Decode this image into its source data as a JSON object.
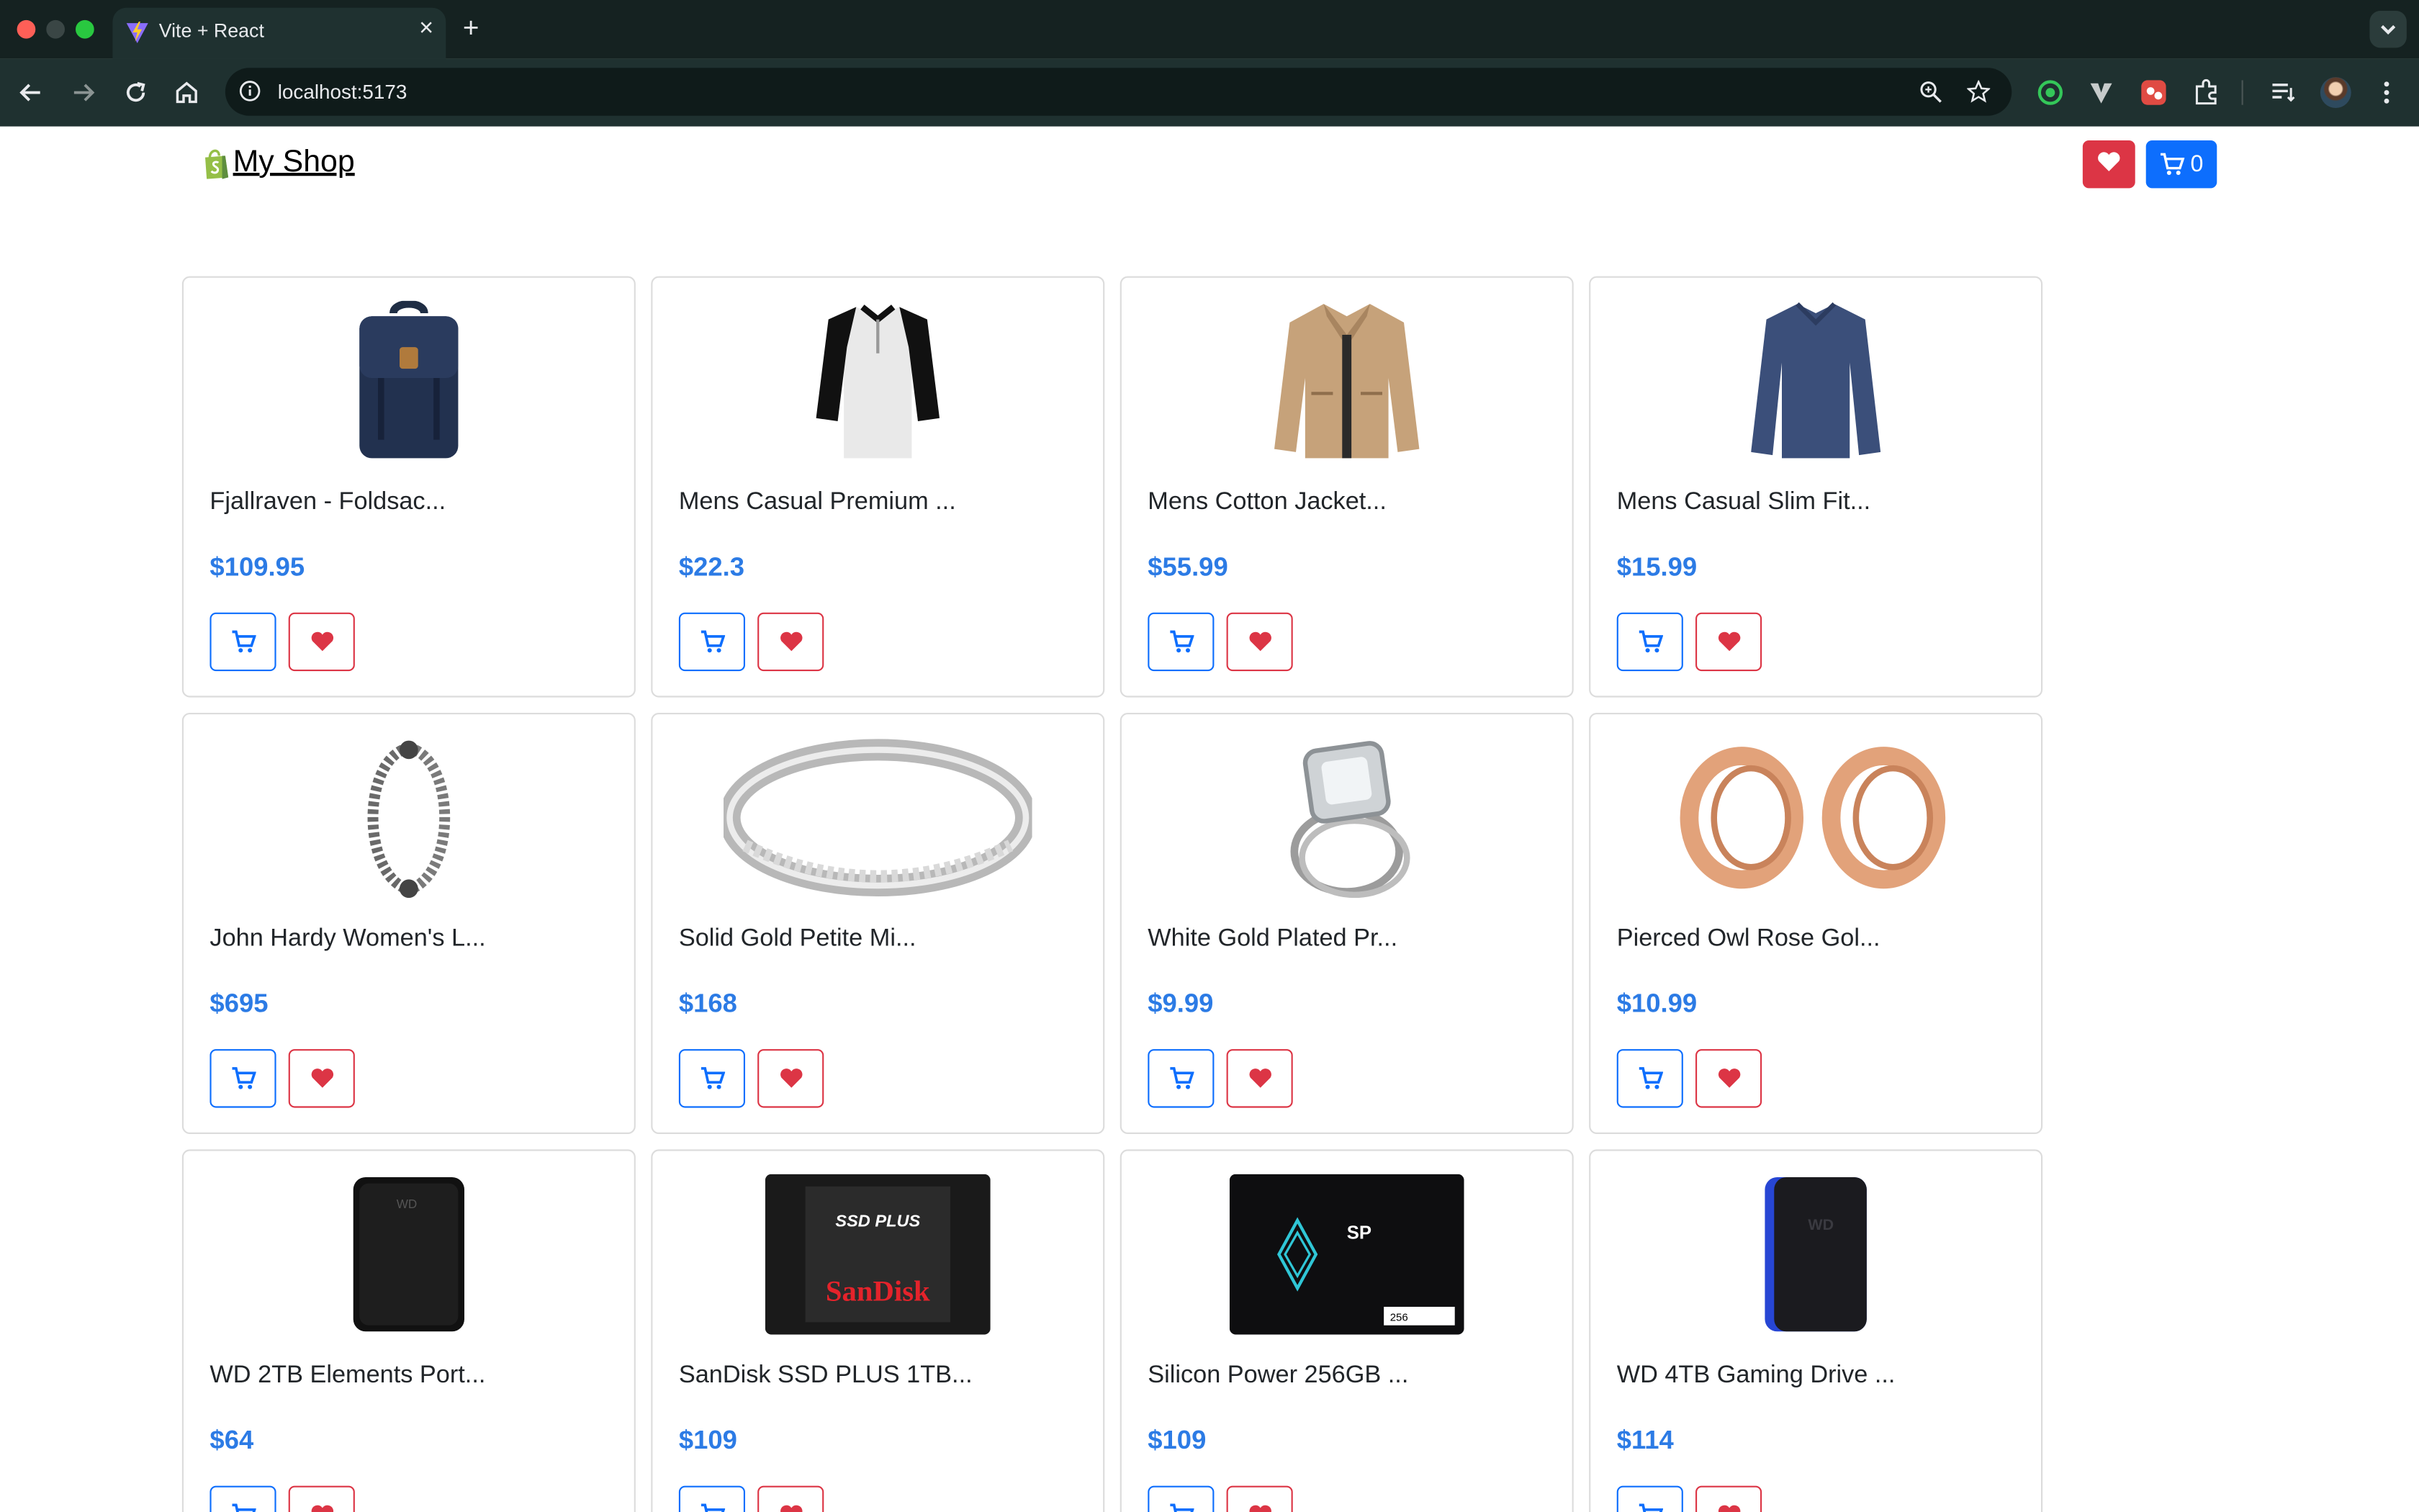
{
  "browser": {
    "tab_title": "Vite + React",
    "url": "localhost:5173"
  },
  "header": {
    "brand": "My Shop",
    "cart_count": "0"
  },
  "colors": {
    "primary": "#0d6efd",
    "danger": "#dc3545",
    "price": "#2c7be5"
  },
  "products": [
    {
      "title": "Fjallraven - Foldsac...",
      "price": "$109.95",
      "image": "backpack"
    },
    {
      "title": "Mens Casual Premium ...",
      "price": "$22.3",
      "image": "henley-shirt"
    },
    {
      "title": "Mens Cotton Jacket...",
      "price": "$55.99",
      "image": "jacket"
    },
    {
      "title": "Mens Casual Slim Fit...",
      "price": "$15.99",
      "image": "long-sleeve-tee"
    },
    {
      "title": "John Hardy Women's L...",
      "price": "$695",
      "image": "chain-bracelet"
    },
    {
      "title": "Solid Gold Petite Mi...",
      "price": "$168",
      "image": "silver-ring"
    },
    {
      "title": "White Gold Plated Pr...",
      "price": "$9.99",
      "image": "diamond-ring"
    },
    {
      "title": "Pierced Owl Rose Gol...",
      "price": "$10.99",
      "image": "rose-gold-tunnels"
    },
    {
      "title": "WD 2TB Elements Port...",
      "price": "$64",
      "image": "external-hdd"
    },
    {
      "title": "SanDisk SSD PLUS 1TB...",
      "price": "$109",
      "image": "sandisk-ssd"
    },
    {
      "title": "Silicon Power 256GB ...",
      "price": "$109",
      "image": "sp-ssd"
    },
    {
      "title": "WD 4TB Gaming Drive ...",
      "price": "$114",
      "image": "gaming-drive"
    }
  ]
}
